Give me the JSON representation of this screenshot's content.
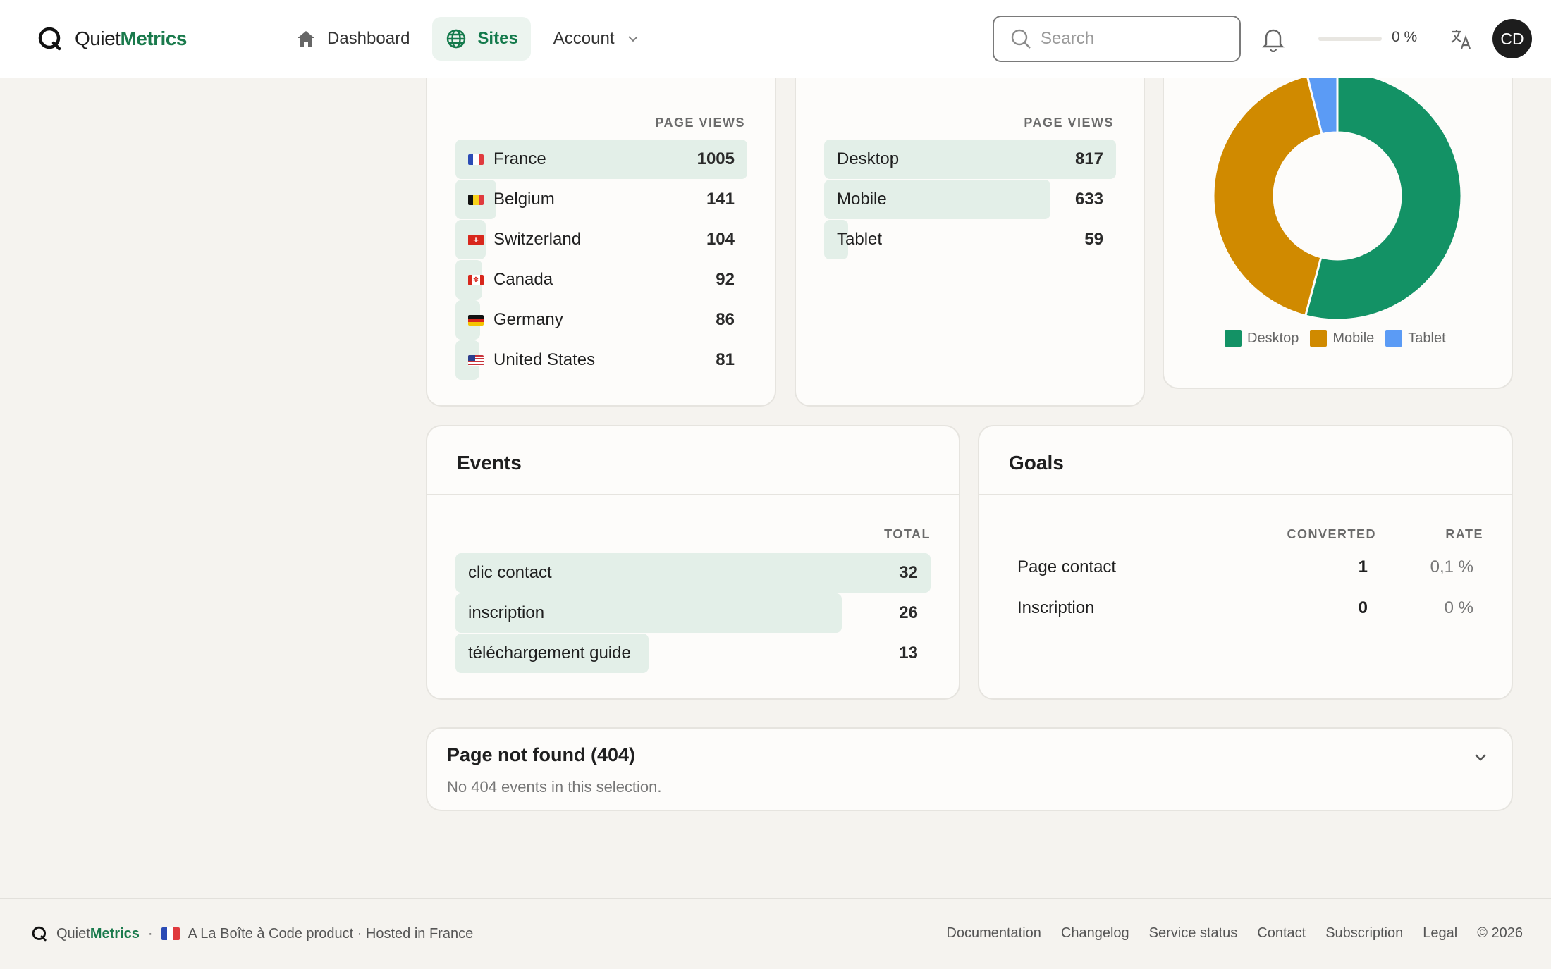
{
  "header": {
    "brand_light": "Quiet",
    "brand_bold": "Metrics",
    "nav": [
      {
        "label": "Dashboard",
        "icon": "home-icon"
      },
      {
        "label": "Sites",
        "icon": "globe-icon"
      },
      {
        "label": "Account",
        "icon": "chevron-down-icon"
      }
    ],
    "search_placeholder": "Search",
    "progress_value": 0,
    "progress_label": "0 %",
    "avatar_initials": "CD"
  },
  "countries": {
    "column_header": "PAGE VIEWS",
    "rows": [
      {
        "flag": "fr",
        "label": "France",
        "value": "1005"
      },
      {
        "flag": "be",
        "label": "Belgium",
        "value": "141"
      },
      {
        "flag": "ch",
        "label": "Switzerland",
        "value": "104"
      },
      {
        "flag": "ca",
        "label": "Canada",
        "value": "92"
      },
      {
        "flag": "de",
        "label": "Germany",
        "value": "86"
      },
      {
        "flag": "us",
        "label": "United States",
        "value": "81"
      }
    ]
  },
  "devices": {
    "column_header": "PAGE VIEWS",
    "rows": [
      {
        "label": "Desktop",
        "value": "817"
      },
      {
        "label": "Mobile",
        "value": "633"
      },
      {
        "label": "Tablet",
        "value": "59"
      }
    ]
  },
  "chart_data": {
    "type": "pie",
    "categories": [
      "Desktop",
      "Mobile",
      "Tablet"
    ],
    "values": [
      817,
      633,
      59
    ],
    "colors": [
      "#139265",
      "#d08a00",
      "#5b9bf5"
    ],
    "title": "",
    "legend": "bottom"
  },
  "events": {
    "title": "Events",
    "column_header": "TOTAL",
    "rows": [
      {
        "label": "clic contact",
        "value": "32"
      },
      {
        "label": "inscription",
        "value": "26"
      },
      {
        "label": "téléchargement guide",
        "value": "13"
      }
    ]
  },
  "goals": {
    "title": "Goals",
    "col_converted": "CONVERTED",
    "col_rate": "RATE",
    "rows": [
      {
        "label": "Page contact",
        "converted": "1",
        "rate": "0,1 %"
      },
      {
        "label": "Inscription",
        "converted": "0",
        "rate": "0 %"
      }
    ]
  },
  "not_found": {
    "title": "Page not found (404)",
    "message": "No 404 events in this selection."
  },
  "footer": {
    "brand_light": "Quiet",
    "brand_bold": "Metrics",
    "tagline": "A La Boîte à Code product · Hosted in France",
    "links": [
      "Documentation",
      "Changelog",
      "Service status",
      "Contact",
      "Subscription",
      "Legal"
    ],
    "copyright": "© 2026"
  },
  "colors": {
    "accent": "#1a7a4c",
    "bar_fill": "#e3efe8"
  }
}
